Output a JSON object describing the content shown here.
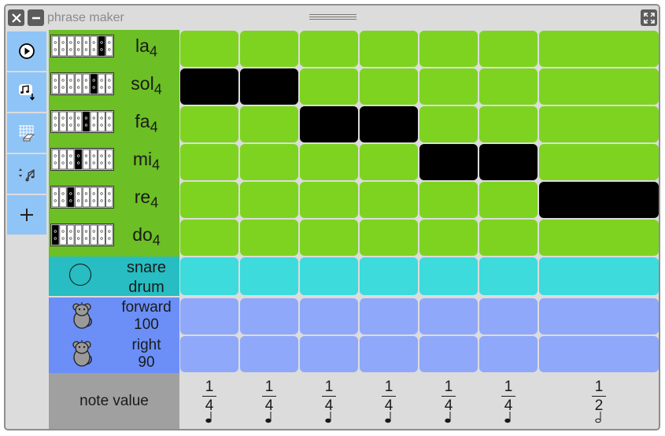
{
  "window": {
    "title": "phrase maker"
  },
  "toolbar": [
    {
      "name": "play-button",
      "icon": "play-icon"
    },
    {
      "name": "save-button",
      "icon": "save-music-icon"
    },
    {
      "name": "erase-button",
      "icon": "erase-grid-icon"
    },
    {
      "name": "sort-button",
      "icon": "sort-notes-icon"
    },
    {
      "name": "add-note-button",
      "icon": "plus-icon"
    }
  ],
  "pitches": [
    {
      "name": "la",
      "octave": "4",
      "key_index": 6
    },
    {
      "name": "sol",
      "octave": "4",
      "key_index": 5
    },
    {
      "name": "fa",
      "octave": "4",
      "key_index": 4
    },
    {
      "name": "mi",
      "octave": "4",
      "key_index": 3
    },
    {
      "name": "re",
      "octave": "4",
      "key_index": 2
    },
    {
      "name": "do",
      "octave": "4",
      "key_index": 0
    }
  ],
  "drum": {
    "line1": "snare",
    "line2": "drum"
  },
  "actions": [
    {
      "line1": "forward",
      "line2": "100"
    },
    {
      "line1": "right",
      "line2": "90"
    }
  ],
  "note_value_label": "note value",
  "columns": [
    {
      "num": "1",
      "den": "4",
      "note": "quarter"
    },
    {
      "num": "1",
      "den": "4",
      "note": "quarter"
    },
    {
      "num": "1",
      "den": "4",
      "note": "quarter"
    },
    {
      "num": "1",
      "den": "4",
      "note": "quarter"
    },
    {
      "num": "1",
      "den": "4",
      "note": "quarter"
    },
    {
      "num": "1",
      "den": "4",
      "note": "quarter"
    },
    {
      "num": "1",
      "den": "2",
      "note": "half"
    }
  ],
  "selected_notes": [
    [
      1,
      0
    ],
    [
      1,
      1
    ],
    [
      2,
      2
    ],
    [
      2,
      3
    ],
    [
      3,
      4
    ],
    [
      3,
      5
    ],
    [
      4,
      6
    ]
  ],
  "colors": {
    "pitch": "#6cbf24",
    "pitch_cell": "#7ed321",
    "selected": "#000000",
    "drum_label": "#27bdc2",
    "drum_cell": "#3ddbdb",
    "action_label": "#6b8ff7",
    "action_cell": "#8fa8fa",
    "note_label": "#a0a0a0",
    "sidebar_button": "#8fc4f7"
  }
}
